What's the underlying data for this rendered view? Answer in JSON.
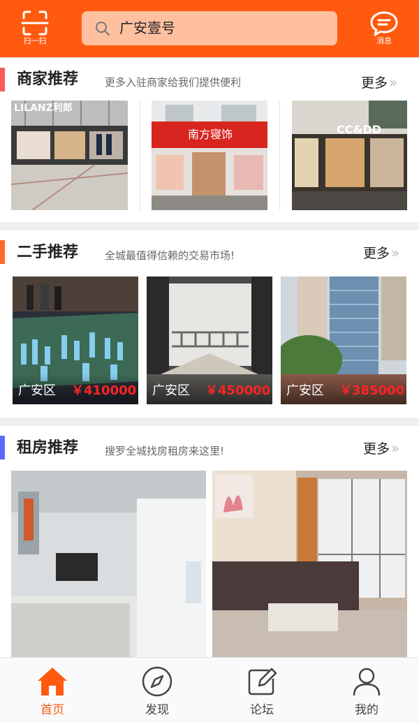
{
  "header": {
    "scan_label": "扫一扫",
    "search_value": "广安壹号",
    "message_label": "消息"
  },
  "sections": [
    {
      "title": "商家推荐",
      "subtitle": "更多入驻商家给我们提供便利",
      "more": "更多",
      "accent": "#ff5a5a",
      "shops": [
        {
          "sign": "LILANZ利郎"
        },
        {
          "sign": "南方寝饰"
        },
        {
          "sign": "CC&DD"
        }
      ]
    },
    {
      "title": "二手推荐",
      "subtitle": "全城最值得信赖的交易市场!",
      "more": "更多",
      "accent": "#ff6a2a",
      "items": [
        {
          "area": "广安区",
          "price": "￥410000"
        },
        {
          "area": "广安区",
          "price": "￥450000"
        },
        {
          "area": "广安区",
          "price": "￥385000"
        }
      ]
    },
    {
      "title": "租房推荐",
      "subtitle": "搜罗全城找房租房来这里!",
      "more": "更多",
      "accent": "#5a6aff"
    }
  ],
  "tabbar": [
    {
      "label": "首页",
      "icon": "home-icon",
      "active": true
    },
    {
      "label": "发现",
      "icon": "compass-icon",
      "active": false
    },
    {
      "label": "论坛",
      "icon": "edit-icon",
      "active": false
    },
    {
      "label": "我的",
      "icon": "user-icon",
      "active": false
    }
  ],
  "colors": {
    "brand": "#ff5a10",
    "search_bg": "#ffc0a0",
    "price": "#ff2424"
  }
}
